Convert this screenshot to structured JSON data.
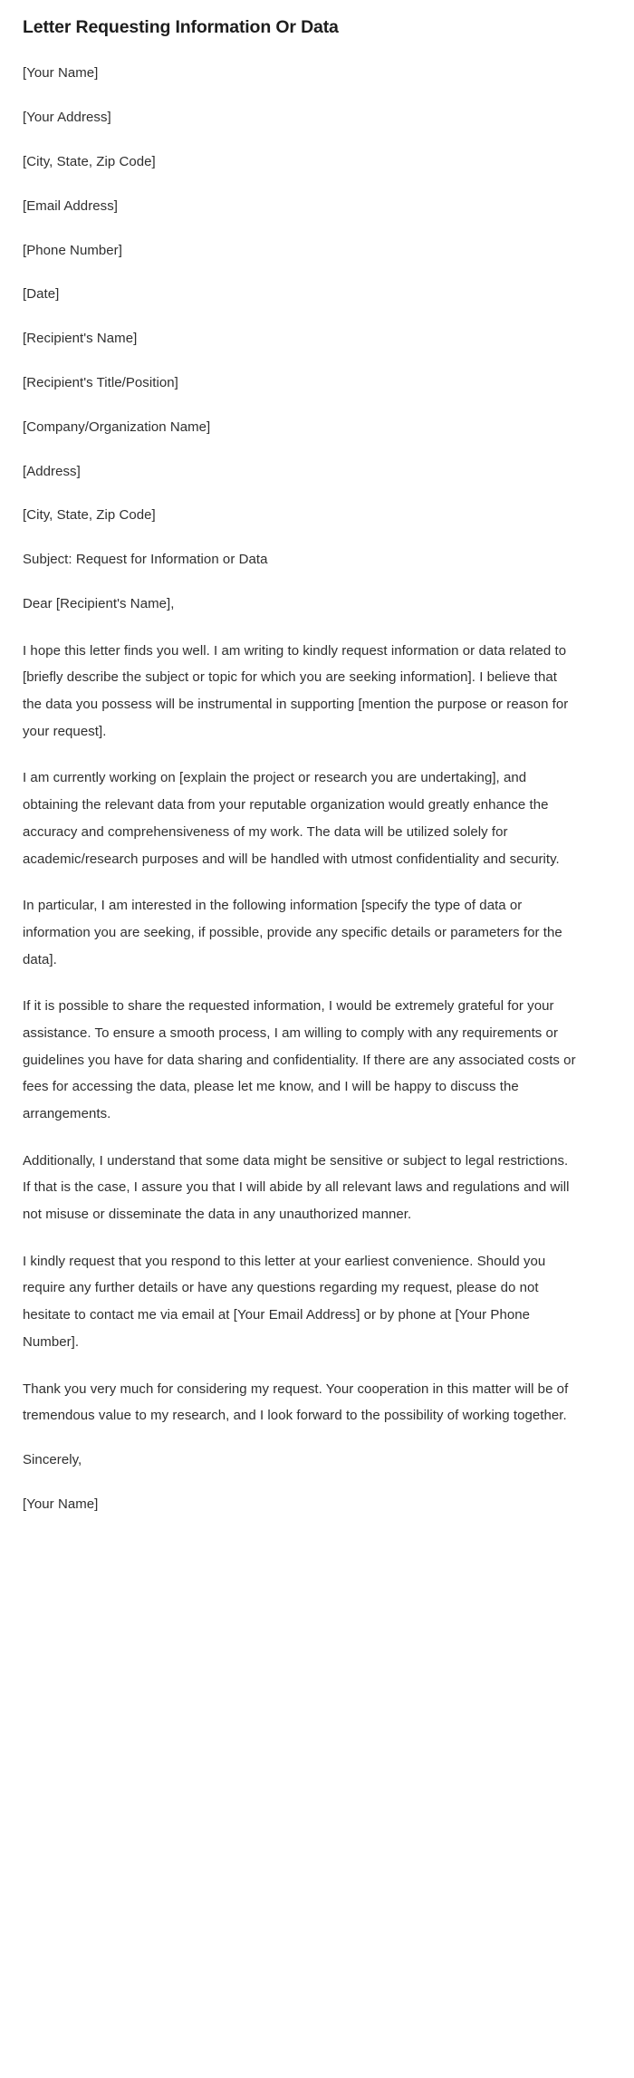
{
  "document": {
    "title": "Letter Requesting Information Or Data",
    "sender_block": [
      "[Your Name]",
      "[Your Address]",
      "[City, State, Zip Code]",
      "[Email Address]",
      "[Phone Number]",
      "[Date]"
    ],
    "recipient_block": [
      "[Recipient's Name]",
      "[Recipient's Title/Position]",
      "[Company/Organization Name]",
      "[Address]",
      "[City, State, Zip Code]"
    ],
    "subject_line": "Subject: Request for Information or Data",
    "salutation": "Dear [Recipient's Name],",
    "body_paragraphs": [
      "I hope this letter finds you well. I am writing to kindly request information or data related to [briefly describe the subject or topic for which you are seeking information]. I believe that the data you possess will be instrumental in supporting [mention the purpose or reason for your request].",
      "I am currently working on [explain the project or research you are undertaking], and obtaining the relevant data from your reputable organization would greatly enhance the accuracy and comprehensiveness of my work. The data will be utilized solely for academic/research purposes and will be handled with utmost confidentiality and security.",
      "In particular, I am interested in the following information [specify the type of data or information you are seeking, if possible, provide any specific details or parameters for the data].",
      "If it is possible to share the requested information, I would be extremely grateful for your assistance. To ensure a smooth process, I am willing to comply with any requirements or guidelines you have for data sharing and confidentiality. If there are any associated costs or fees for accessing the data, please let me know, and I will be happy to discuss the arrangements.",
      "Additionally, I understand that some data might be sensitive or subject to legal restrictions. If that is the case, I assure you that I will abide by all relevant laws and regulations and will not misuse or disseminate the data in any unauthorized manner.",
      "I kindly request that you respond to this letter at your earliest convenience. Should you require any further details or have any questions regarding my request, please do not hesitate to contact me via email at [Your Email Address] or by phone at [Your Phone Number].",
      "Thank you very much for considering my request. Your cooperation in this matter will be of tremendous value to my research, and I look forward to the possibility of working together."
    ],
    "closing": "Sincerely,",
    "signature_name": "[Your Name]"
  }
}
